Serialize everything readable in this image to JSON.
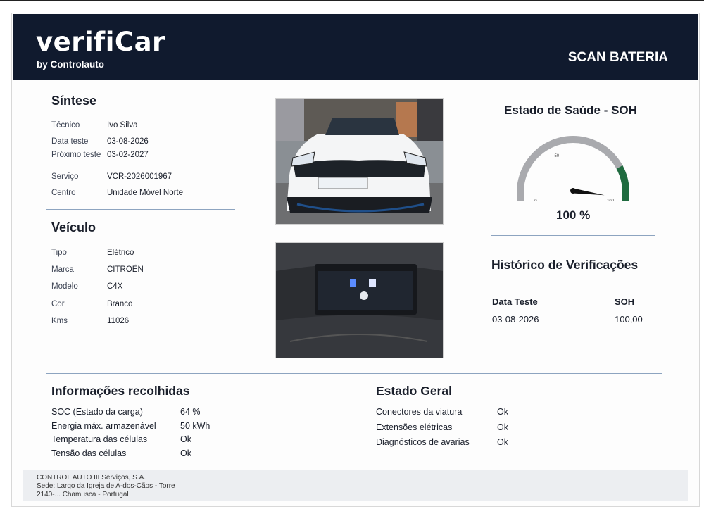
{
  "header": {
    "brand": "verifiCar",
    "brand_sub": "by Controlauto",
    "report_type": "SCAN BATERIA"
  },
  "sintese": {
    "title": "Síntese",
    "rows": [
      {
        "label": "Técnico",
        "value": "Ivo Silva"
      },
      {
        "label": "Data teste",
        "value": "03-08-2026"
      },
      {
        "label": "Próximo teste",
        "value": "03-02-2027"
      },
      {
        "label": "Serviço",
        "value": "VCR-2026001967"
      },
      {
        "label": "Centro",
        "value": "Unidade Móvel Norte"
      }
    ]
  },
  "veiculo": {
    "title": "Veículo",
    "rows": [
      {
        "label": "Tipo",
        "value": "Elétrico"
      },
      {
        "label": "Marca",
        "value": "CITROËN"
      },
      {
        "label": "Modelo",
        "value": "C4X"
      },
      {
        "label": "Cor",
        "value": "Branco"
      },
      {
        "label": "Kms",
        "value": "11026"
      }
    ]
  },
  "soh": {
    "title": "Estado de Saúde - SOH",
    "value_text": "100 %",
    "level": 100,
    "gauge_ticks": [
      "0",
      "50",
      "100"
    ],
    "colors": {
      "track": "#a9aaae",
      "good": "#1f6b3f",
      "needle": "#111111"
    }
  },
  "historico": {
    "title": "Histórico de Verificações",
    "columns": [
      "Data Teste",
      "SOH"
    ],
    "rows": [
      [
        "03-08-2026",
        "100,00"
      ]
    ]
  },
  "informacoes": {
    "title": "Informações recolhidas",
    "rows": [
      {
        "label": "SOC (Estado da carga)",
        "value": "64 %"
      },
      {
        "label": "Energia máx. armazenável",
        "value": "50 kWh"
      },
      {
        "label": "Temperatura das células",
        "value": "Ok"
      },
      {
        "label": "Tensão das células",
        "value": "Ok"
      }
    ]
  },
  "estado_geral": {
    "title": "Estado Geral",
    "rows": [
      {
        "label": "Conectores da viatura",
        "value": "Ok"
      },
      {
        "label": "Extensões elétricas",
        "value": "Ok"
      },
      {
        "label": "Diagnósticos de avarias",
        "value": "Ok"
      }
    ]
  },
  "footer": {
    "line1": "CONTROL AUTO III Serviços, S.A.",
    "line2": "Sede: Largo da Igreja de A-dos-Cãos - Torre",
    "line3": "2140-... Chamusca - Portugal"
  },
  "images": {
    "car_front": "car-front-photo",
    "dashboard": "dashboard-photo"
  }
}
